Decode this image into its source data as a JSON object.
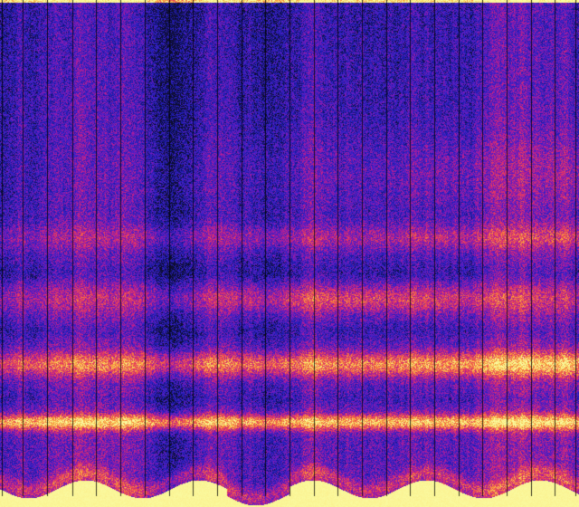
{
  "image": {
    "kind": "spectrogram",
    "colormap": [
      "#0d0d2a",
      "#1b1ba8",
      "#3a22c8",
      "#7a1ab8",
      "#c0208a",
      "#e8405a",
      "#f88a3a",
      "#f8d860",
      "#fafaa0"
    ],
    "column_separators": true,
    "top_edge_color": "#fafaa0",
    "bottom_fill_color": "#fafaa0"
  }
}
